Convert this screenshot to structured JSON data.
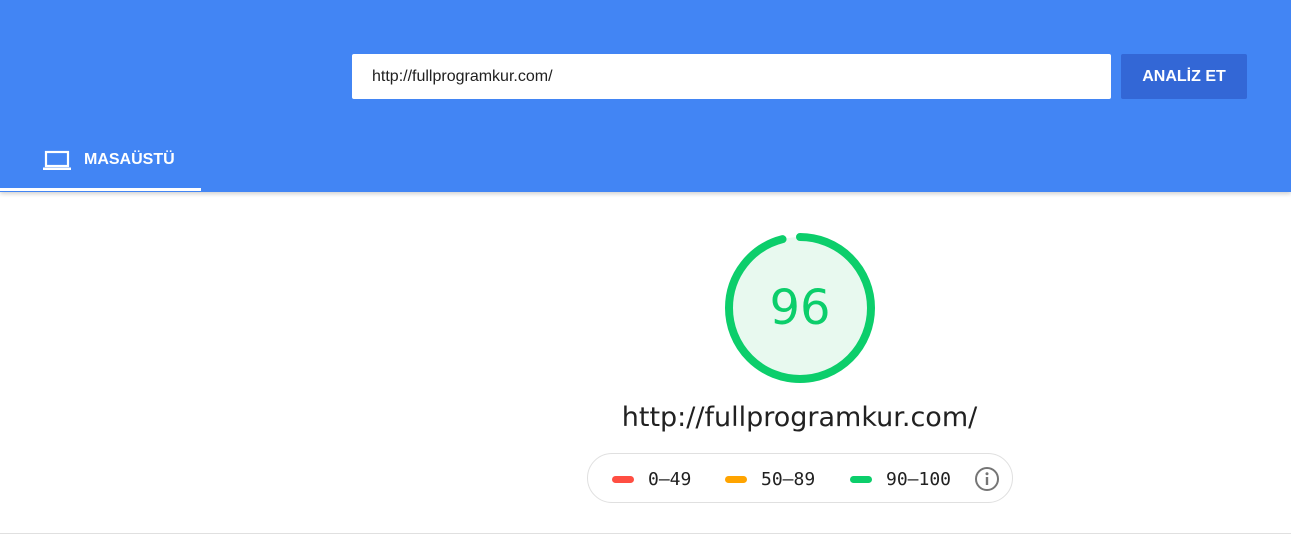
{
  "search": {
    "url_value": "http://fullprogramkur.com/",
    "analyze_label": "ANALİZ ET"
  },
  "tabs": [
    {
      "label": "MASAÜSTÜ",
      "icon": "laptop-icon",
      "active": true
    }
  ],
  "result": {
    "score": "96",
    "score_fraction": 0.96,
    "url": "http://fullprogramkur.com/"
  },
  "legend": [
    {
      "label": "0–49",
      "color": "#ff4e42"
    },
    {
      "label": "50–89",
      "color": "#ffa400"
    },
    {
      "label": "90–100",
      "color": "#0cce6b"
    }
  ],
  "colors": {
    "header": "#4285f4",
    "button": "#3367d6",
    "good": "#0cce6b",
    "good_fill": "#e8f9ef"
  }
}
